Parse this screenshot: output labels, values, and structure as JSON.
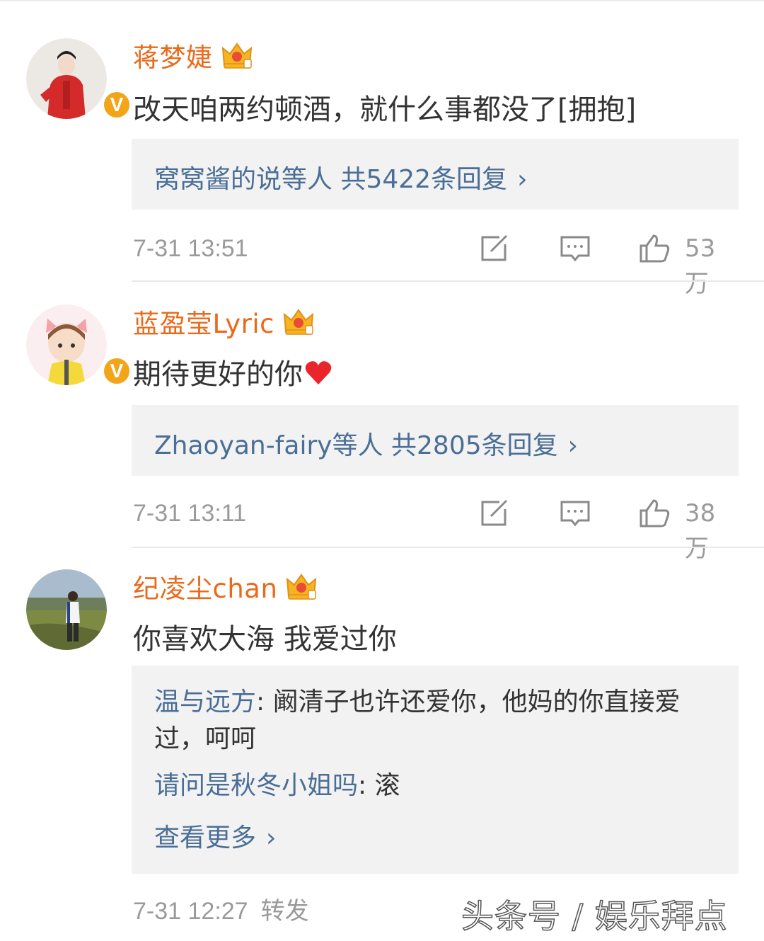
{
  "comments": [
    {
      "username": "蒋梦婕",
      "text": "改天咱两约顿酒，就什么事都没了[拥抱]",
      "reply_summary": "窝窝酱的说等人  共5422条回复",
      "time": "7-31 13:51",
      "likes": "53万",
      "avatar_colors": [
        "#e5e1dd",
        "#d42a2a"
      ]
    },
    {
      "username": "蓝盈莹Lyric",
      "text": "期待更好的你",
      "reply_summary": "Zhaoyan-fairy等人  共2805条回复",
      "time": "7-31 13:11",
      "likes": "38万",
      "avatar_colors": [
        "#fbeef0",
        "#f4d93a"
      ]
    },
    {
      "username": "纪凌尘chan",
      "text": "你喜欢大海 我爱过你",
      "sub_replies": [
        {
          "author": "温与远方",
          "line1": ": 阚清子也许还爱你，他妈的你直接爱",
          "line2": "过，呵呵"
        },
        {
          "author": "请问是秋冬小姐吗",
          "line1": ": 滚"
        }
      ],
      "more_label": "查看更多",
      "time": "7-31 12:27",
      "repost_label": "转发",
      "avatar_colors": [
        "#8aa0b8",
        "#5f7040"
      ]
    }
  ],
  "verified_badge": "V",
  "watermark": "头条号 / 娱乐拜点",
  "colors": {
    "username": "#ea6a1b",
    "link": "#4a6e96",
    "meta": "#9a9a9a",
    "reply_bg": "#f2f2f2",
    "badge": "#f3a51a"
  },
  "icons": [
    "crown-icon",
    "verified-icon",
    "repost-icon",
    "comment-icon",
    "like-icon",
    "heart-emoji-icon",
    "chevron-right-icon"
  ]
}
